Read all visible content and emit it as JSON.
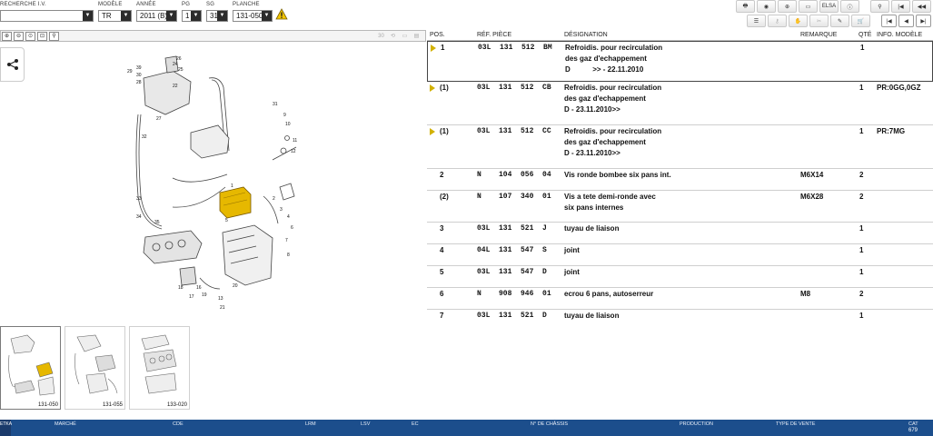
{
  "selectors": {
    "recherche": {
      "label": "RECHERCHE I.V.",
      "value": ""
    },
    "modele": {
      "label": "MODÈLE",
      "value": "TR"
    },
    "annee": {
      "label": "ANNÉE",
      "value": "2011 (B)"
    },
    "pg": {
      "label": "PG",
      "value": "1"
    },
    "sg": {
      "label": "SG",
      "value": "31"
    },
    "planche": {
      "label": "PLANCHE",
      "value": "131-050"
    }
  },
  "toolbar_top": [
    "print",
    "camera",
    "cart-add",
    "car",
    "filter",
    "info",
    "pin",
    "first",
    "previous"
  ],
  "toolbar_top_labels": {
    "filter": "ELSA"
  },
  "zoom": {
    "counter": "30"
  },
  "table": {
    "headers": {
      "pos": "POS.",
      "ref": "RÉF. PIÈCE",
      "designation": "DÉSIGNATION",
      "remarque": "REMARQUE",
      "qte": "QTÉ",
      "info": "INFO. MODÈLE"
    },
    "rows": [
      {
        "arrow": true,
        "pos": "1",
        "ref": "03L  131  512  BM",
        "lines": [
          "Refroidis. pour recirculation",
          "des gaz d'echappement",
          "D           >> - 22.11.2010"
        ],
        "remarque": "",
        "qte": "1",
        "info": ""
      },
      {
        "arrow": true,
        "pos": "(1)",
        "ref": "03L  131  512  CB",
        "lines": [
          "Refroidis. pour recirculation",
          "des gaz d'echappement",
          "D - 23.11.2010>>"
        ],
        "remarque": "",
        "qte": "1",
        "info": "PR:0GG,0GZ"
      },
      {
        "arrow": true,
        "pos": "(1)",
        "ref": "03L  131  512  CC",
        "lines": [
          "Refroidis. pour recirculation",
          "des gaz d'echappement",
          "D - 23.11.2010>>"
        ],
        "remarque": "",
        "qte": "1",
        "info": "PR:7MG"
      },
      {
        "arrow": false,
        "pos": "2",
        "ref": "N    104  056  04",
        "lines": [
          "Vis ronde bombee six pans int."
        ],
        "remarque": "M6X14",
        "qte": "2",
        "info": ""
      },
      {
        "arrow": false,
        "pos": "(2)",
        "ref": "N    107  340  01",
        "lines": [
          "Vis a tete demi-ronde avec",
          "six pans internes"
        ],
        "remarque": "M6X28",
        "qte": "2",
        "info": ""
      },
      {
        "arrow": false,
        "pos": "3",
        "ref": "03L  131  521  J",
        "lines": [
          "tuyau de liaison"
        ],
        "remarque": "",
        "qte": "1",
        "info": ""
      },
      {
        "arrow": false,
        "pos": "4",
        "ref": "04L  131  547  S",
        "lines": [
          "joint"
        ],
        "remarque": "",
        "qte": "1",
        "info": ""
      },
      {
        "arrow": false,
        "pos": "5",
        "ref": "03L  131  547  D",
        "lines": [
          "joint"
        ],
        "remarque": "",
        "qte": "1",
        "info": ""
      },
      {
        "arrow": false,
        "pos": "6",
        "ref": "N    908  946  01",
        "lines": [
          "ecrou 6 pans, autoserreur"
        ],
        "remarque": "M8",
        "qte": "2",
        "info": ""
      },
      {
        "arrow": false,
        "pos": "7",
        "ref": "03L  131  521  D",
        "lines": [
          "tuyau de liaison"
        ],
        "remarque": "",
        "qte": "1",
        "info": ""
      }
    ]
  },
  "thumbnails": [
    {
      "label": "131-050",
      "active": true
    },
    {
      "label": "131-055",
      "active": false
    },
    {
      "label": "133-020",
      "active": false
    }
  ],
  "diagram_callouts": [
    "39",
    "29",
    "30",
    "28",
    "26",
    "24",
    "25",
    "22",
    "27",
    "32",
    "31",
    "33",
    "34",
    "35",
    "5",
    "1",
    "2",
    "3",
    "4",
    "6",
    "7",
    "8",
    "9",
    "10",
    "11",
    "12",
    "13",
    "16",
    "17",
    "18",
    "19",
    "20",
    "21"
  ],
  "statusbar": {
    "logo": "ETKA",
    "fields": [
      {
        "label": "MARCHÉ",
        "value": ""
      },
      {
        "label": "CDE",
        "value": ""
      },
      {
        "label": "LRM",
        "value": ""
      },
      {
        "label": "LSV",
        "value": ""
      },
      {
        "label": "EC",
        "value": ""
      },
      {
        "label": "N° DE CHÂSSIS",
        "value": ""
      },
      {
        "label": "PRODUCTION",
        "value": ""
      },
      {
        "label": "TYPE DE VENTE",
        "value": ""
      },
      {
        "label": "CAT",
        "value": "679"
      }
    ]
  },
  "colors": {
    "accent_blue": "#1c4e8c",
    "highlight_part": "#e6b800",
    "arrow": "#d2b100"
  }
}
